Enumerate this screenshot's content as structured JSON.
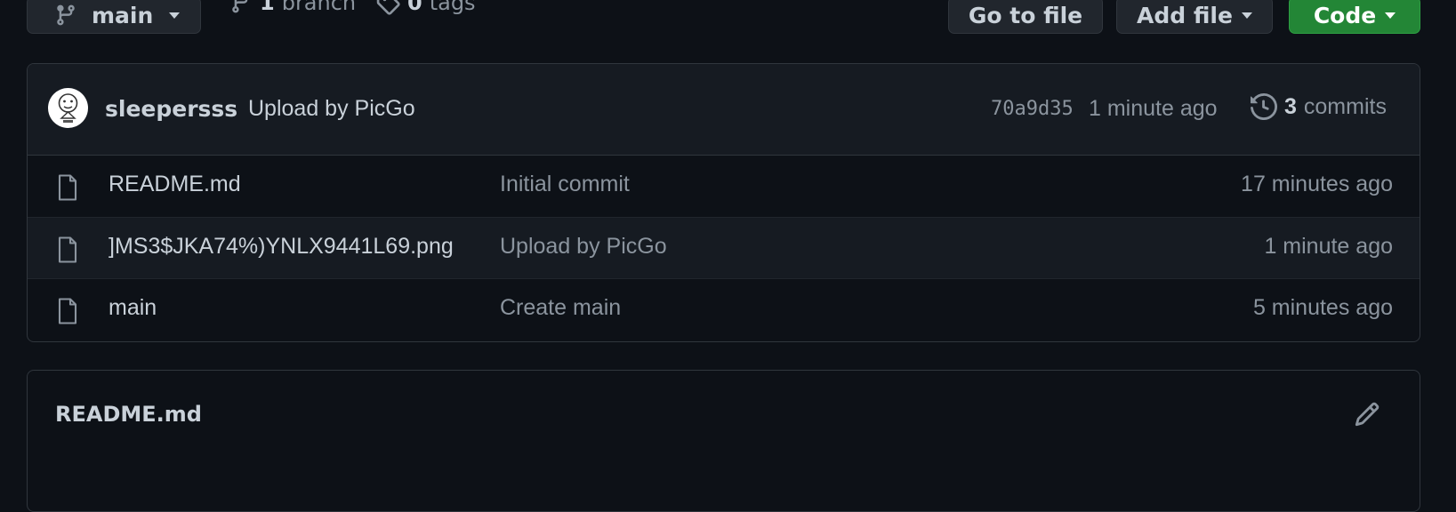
{
  "toolbar": {
    "branch_button": "main",
    "branch_count": "1",
    "branch_label": "branch",
    "tag_count": "0",
    "tag_label": "tags",
    "go_to_file": "Go to file",
    "add_file": "Add file",
    "code": "Code"
  },
  "latest_commit": {
    "author": "sleepersss",
    "message": "Upload by PicGo",
    "sha": "70a9d35",
    "time": "1 minute ago",
    "commit_count": "3",
    "commit_label": "commits"
  },
  "files": [
    {
      "name": "README.md",
      "message": "Initial commit",
      "age": "17 minutes ago"
    },
    {
      "name": "]MS3$JKA74%)YNLX9441L69.png",
      "message": "Upload by PicGo",
      "age": "1 minute ago"
    },
    {
      "name": "main",
      "message": "Create main",
      "age": "5 minutes ago"
    }
  ],
  "readme": {
    "title": "README.md"
  },
  "colors": {
    "background": "#0d1117",
    "panel": "#161b22",
    "border": "#30363d",
    "code_button": "#238636"
  }
}
